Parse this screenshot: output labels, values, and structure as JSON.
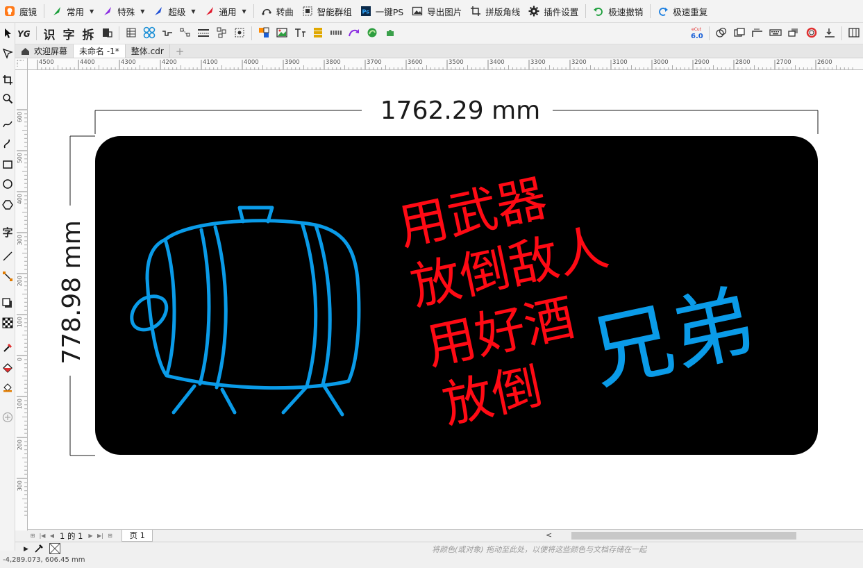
{
  "toolbar_main": {
    "app_name": "魔镜",
    "items": [
      {
        "label": "常用",
        "icon": "green-quill-icon",
        "color": "#1a9e3a"
      },
      {
        "label": "特殊",
        "icon": "purple-quill-icon",
        "color": "#8a2be2"
      },
      {
        "label": "超级",
        "icon": "blue-quill-icon",
        "color": "#1f4fd6"
      },
      {
        "label": "通用",
        "icon": "red-quill-icon",
        "color": "#e0182b"
      }
    ],
    "actions": [
      {
        "label": "转曲",
        "icon": "convert-curve-icon"
      },
      {
        "label": "智能群组",
        "icon": "smart-group-icon"
      },
      {
        "label": "一键PS",
        "icon": "photoshop-icon"
      },
      {
        "label": "导出图片",
        "icon": "export-image-icon"
      },
      {
        "label": "拼版角线",
        "icon": "crop-marks-icon"
      },
      {
        "label": "插件设置",
        "icon": "gear-icon"
      },
      {
        "label": "极速撤销",
        "icon": "undo-icon"
      },
      {
        "label": "极速重复",
        "icon": "redo-icon"
      }
    ]
  },
  "toolbar_secondary": {
    "text_buttons": [
      "识",
      "字",
      "拆"
    ],
    "cut_badge": "6.0"
  },
  "tabs": [
    {
      "label": "欢迎屏幕"
    },
    {
      "label": "未命名 -1*"
    },
    {
      "label": "整体.cdr"
    }
  ],
  "ruler": {
    "top_labels": [
      "4500",
      "4400",
      "4300",
      "4200",
      "4100",
      "4000",
      "3900",
      "3800",
      "3700",
      "3600",
      "3500",
      "3400",
      "3300",
      "3200",
      "3100",
      "3000",
      "2900",
      "2800",
      "2700",
      "2600"
    ],
    "left_labels": [
      "600",
      "500",
      "400",
      "300",
      "200",
      "100",
      "0",
      "100",
      "200",
      "300"
    ]
  },
  "artwork": {
    "width_label": "1762.29 mm",
    "height_label": "778.98 mm",
    "red_lines": [
      "用武器",
      "放倒敌人",
      "用好酒",
      "放倒"
    ],
    "blue_text": "兄弟",
    "colors": {
      "board": "#000000",
      "red": "#ff0a14",
      "blue": "#0a9be8",
      "dimension": "#1a1a1a"
    }
  },
  "pagebar": {
    "page_of": "1 的 1",
    "page_tab": "页 1"
  },
  "palette": {
    "hint": "将颜色(或对象) 拖动至此处，以便将这些颜色与文档存储在一起"
  },
  "status": {
    "coords": "-4,289.073, 606.45 mm"
  }
}
